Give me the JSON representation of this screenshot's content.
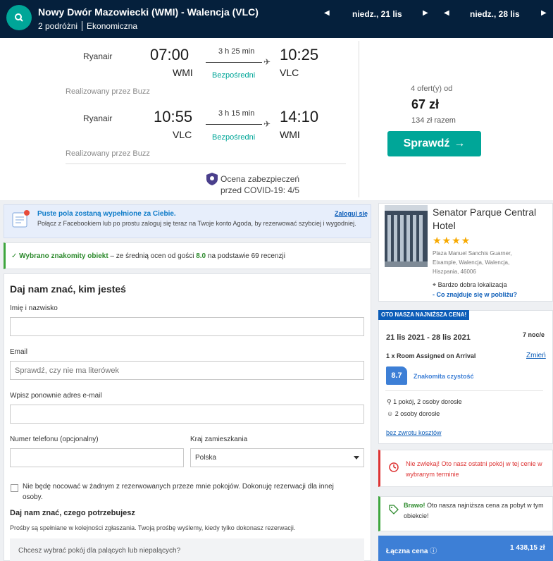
{
  "header": {
    "route": "Nowy Dwór Mazowiecki (WMI) - Walencja (VLC)",
    "travellers": "2 podróżni",
    "cabin": "Ekonomiczna",
    "date_out": "niedz., 21 lis",
    "date_back": "niedz., 28 lis"
  },
  "flights": [
    {
      "airline": "Ryanair",
      "dep_time": "07:00",
      "dep_code": "WMI",
      "duration": "3 h 25 min",
      "stops": "Bezpośredni",
      "arr_time": "10:25",
      "arr_code": "VLC",
      "operated": "Realizowany przez Buzz"
    },
    {
      "airline": "Ryanair",
      "dep_time": "10:55",
      "dep_code": "VLC",
      "duration": "3 h 15 min",
      "stops": "Bezpośredni",
      "arr_time": "14:10",
      "arr_code": "WMI",
      "operated": "Realizowany przez Buzz"
    }
  ],
  "covid": {
    "line1": "Ocena zabezpieczeń",
    "line2": "przed COVID-19: 4/5"
  },
  "offer": {
    "count": "4 ofert(y) od",
    "price": "67 zł",
    "total": "134 zł razem",
    "button": "Sprawdź"
  },
  "facebook": {
    "title": "Puste pola zostaną wypełnione za Ciebie.",
    "sub": "Połącz z Facebookiem lub po prostu zaloguj się teraz na Twoje konto Agoda, by rezerwować szybciej i wygodniej.",
    "login": "Zaloguj się"
  },
  "great": {
    "bold": "Wybrano znakomity obiekt",
    "mid": " – ze średnią ocen od gości ",
    "score": "8.0",
    "tail": " na podstawie 69 recenzji"
  },
  "form": {
    "title": "Daj nam znać, kim jesteś",
    "name_label": "Imię i nazwisko",
    "email_label": "Email",
    "email_placeholder": "Sprawdź, czy nie ma literówek",
    "email2_label": "Wpisz ponownie adres e-mail",
    "phone_label": "Numer telefonu (opcjonalny)",
    "country_label": "Kraj zamieszkania",
    "country_value": "Polska",
    "checkbox_label": "Nie będę nocować w żadnym z rezerwowanych przeze mnie pokojów. Dokonuję rezerwacji dla innej osoby.",
    "needs_title": "Daj nam znać, czego potrzebujesz",
    "needs_sub": "Prośby są spełniane w kolejności zgłaszania. Twoją prośbę wyślemy, kiedy tylko dokonasz rezerwacji.",
    "smoke_question": "Chcesz wybrać pokój dla palących lub niepalących?"
  },
  "hotel": {
    "name": "Senator Parque Central Hotel",
    "stars": "★★★★",
    "address": "Plaza Manuel Sanchis Guarner, Eixample, Walencja, Walencja, Hiszpania, 46006",
    "location": "Bardzo dobra lokalizacja",
    "nearby": "- Co znajduje się w pobliżu?"
  },
  "deal": {
    "tag": "OTO NASZA NAJNIŻSZA CENA!",
    "dates": "21 lis 2021 - 28 lis 2021",
    "nights": "7 noc/e",
    "room": "1 x Room Assigned on Arrival",
    "change": "Zmień",
    "score": "8.7",
    "clean": "Znakomita czystość",
    "occupancy": "1 pokój, 2 osoby dorosłe",
    "guests": "2 osoby dorosłe",
    "refund": "bez zwrotu kosztów"
  },
  "alerts": {
    "red": "Nie zwlekaj! Oto nasz ostatni pokój w tej cenie w wybranym terminie",
    "green_bold": "Brawo!",
    "green_rest": " Oto nasza najniższa cena za pobyt w tym obiekcie!"
  },
  "total": {
    "label": "Łączna cena",
    "value": "1 438,15 zł"
  }
}
